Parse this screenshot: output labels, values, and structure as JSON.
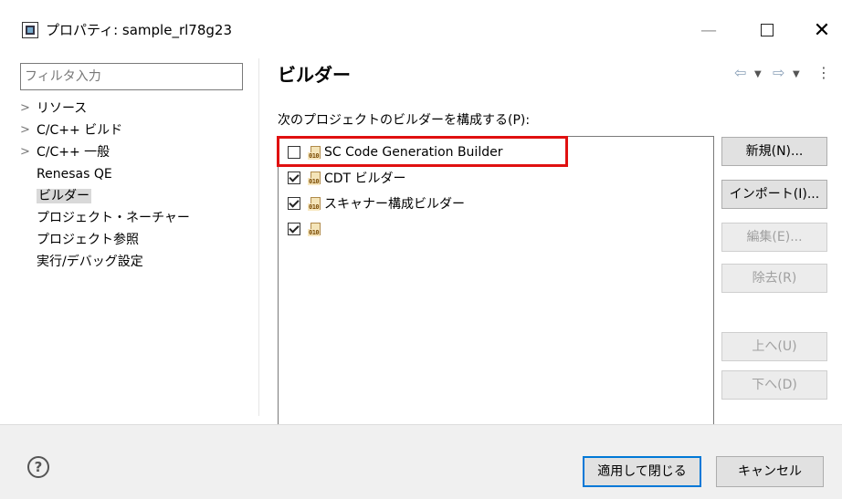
{
  "window": {
    "title": "プロパティ: sample_rl78g23",
    "minimize_glyph": "—",
    "close_glyph": "✕"
  },
  "nav": {
    "filter_placeholder": "フィルタ入力",
    "items": [
      {
        "label": "リソース",
        "expandable": true
      },
      {
        "label": "C/C++ ビルド",
        "expandable": true
      },
      {
        "label": "C/C++ 一般",
        "expandable": true
      },
      {
        "label": "Renesas QE",
        "expandable": false
      },
      {
        "label": "ビルダー",
        "expandable": false,
        "selected": true
      },
      {
        "label": "プロジェクト・ネーチャー",
        "expandable": false
      },
      {
        "label": "プロジェクト参照",
        "expandable": false
      },
      {
        "label": "実行/デバッグ設定",
        "expandable": false
      }
    ]
  },
  "page": {
    "title": "ビルダー",
    "section_label": "次のプロジェクトのビルダーを構成する(P):",
    "builders": [
      {
        "label": "SC Code Generation Builder",
        "checked": false,
        "icon": "binary-file-icon"
      },
      {
        "label": "CDT ビルダー",
        "checked": true,
        "icon": "binary-file-icon"
      },
      {
        "label": "スキャナー構成ビルダー",
        "checked": true,
        "icon": "binary-file-icon"
      },
      {
        "label": "",
        "checked": true,
        "icon": "binary-file-icon"
      }
    ],
    "buttons": {
      "new": "新規(N)...",
      "import": "インポート(I)...",
      "edit": "編集(E)...",
      "remove": "除去(R)",
      "up": "上へ(U)",
      "down": "下へ(D)"
    },
    "history": {
      "back_glyph": "⇦",
      "forward_glyph": "⇨",
      "dropdown_glyph": "▼",
      "menu_glyph": "⋮"
    }
  },
  "footer": {
    "help_glyph": "?",
    "apply_close": "適用して閉じる",
    "cancel": "キャンセル"
  },
  "colors": {
    "highlight": "#e01010",
    "focus": "#0078d7"
  }
}
